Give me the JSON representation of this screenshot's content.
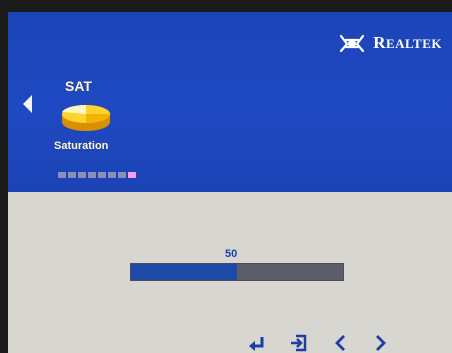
{
  "brand": {
    "name_first": "R",
    "name_rest": "EALTEK"
  },
  "menu": {
    "title": "SAT",
    "caption": "Saturation",
    "icon": "saturation-icon",
    "page_indicator": {
      "count": 8,
      "active_index": 7
    }
  },
  "slider": {
    "value": "50",
    "fraction": 0.5
  },
  "nav": {
    "buttons": [
      "enter-icon",
      "exit-icon",
      "left-arrow-icon",
      "right-arrow-icon"
    ]
  },
  "colors": {
    "panel": "#1f49c2",
    "slider_fill": "#1d4aa9",
    "text_warm": "#fff3c9"
  }
}
